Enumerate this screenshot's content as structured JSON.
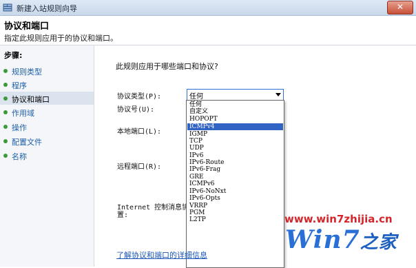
{
  "window": {
    "title": "新建入站规则向导",
    "close_glyph": "✕"
  },
  "header": {
    "title": "协议和端口",
    "description": "指定此规则应用于的协议和端口。"
  },
  "sidebar": {
    "title": "步骤:",
    "items": [
      {
        "label": "规则类型",
        "active": false
      },
      {
        "label": "程序",
        "active": false
      },
      {
        "label": "协议和端口",
        "active": true
      },
      {
        "label": "作用域",
        "active": false
      },
      {
        "label": "操作",
        "active": false
      },
      {
        "label": "配置文件",
        "active": false
      },
      {
        "label": "名称",
        "active": false
      }
    ]
  },
  "main": {
    "question": "此规则应用于哪些端口和协议?",
    "protocol_type_label": "协议类型(P):",
    "protocol_number_label": "协议号(U):",
    "local_port_label": "本地端口(L):",
    "remote_port_label": "远程端口(R):",
    "icmp_label_line1": "Internet 控制消息协",
    "icmp_label_line2": "置:",
    "protocol_combo": {
      "value": "任何",
      "options": [
        "任何",
        "自定义",
        "HOPOPT",
        "ICMPv4",
        "IGMP",
        "TCP",
        "UDP",
        "IPv6",
        "IPv6-Route",
        "IPv6-Frag",
        "GRE",
        "ICMPv6",
        "IPv6-NoNxt",
        "IPv6-Opts",
        "VRRP",
        "PGM",
        "L2TP"
      ],
      "highlighted": "ICMPv4"
    },
    "help_link": "了解协议和端口的详细信息"
  },
  "watermark": {
    "url": "www.win7zhijia.cn",
    "logo_main": "Win7",
    "logo_sub": "之家"
  },
  "colors": {
    "selection": "#3163c4",
    "link": "#1a55b8",
    "step_bullet": "#3c9a3c",
    "watermark_red": "#d3252a",
    "watermark_blue": "#2a6fd6"
  }
}
